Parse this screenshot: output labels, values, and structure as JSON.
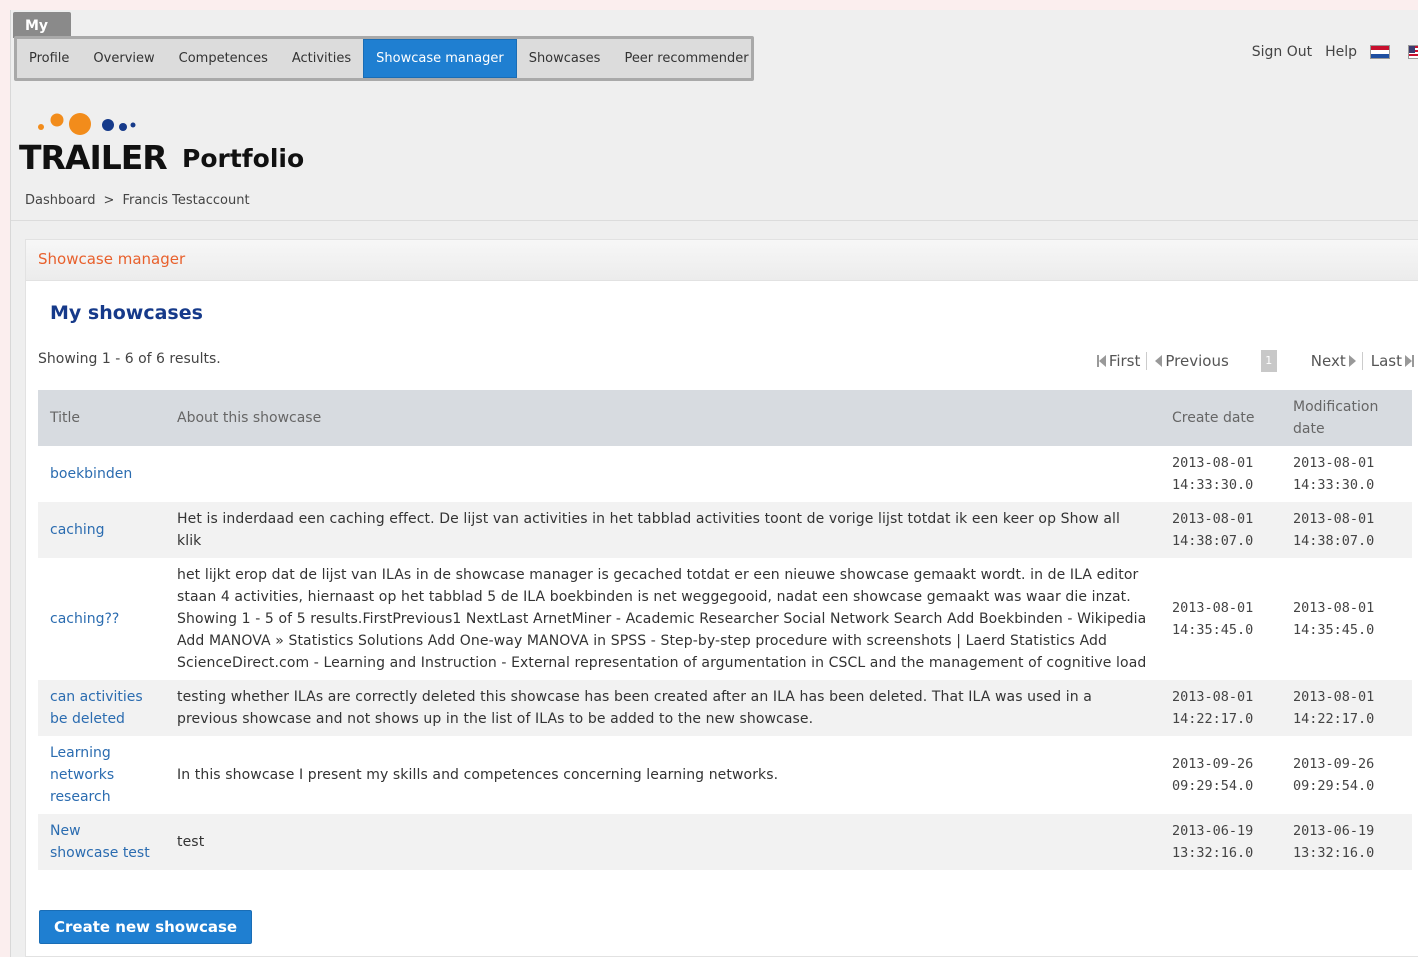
{
  "my_tab": "My",
  "nav": {
    "tabs": [
      {
        "label": "Profile"
      },
      {
        "label": "Overview"
      },
      {
        "label": "Competences"
      },
      {
        "label": "Activities"
      },
      {
        "label": "Showcase manager",
        "active": true
      },
      {
        "label": "Showcases"
      },
      {
        "label": "Peer recommender"
      }
    ]
  },
  "top_links": {
    "sign_out": "Sign Out",
    "help": "Help"
  },
  "logo": {
    "text": "TRAILER",
    "suffix": "Portfolio"
  },
  "breadcrumb": {
    "home": "Dashboard",
    "separator": ">",
    "current": "Francis Testaccount"
  },
  "panel": {
    "header": "Showcase manager",
    "title": "My showcases"
  },
  "results_text": "Showing 1 - 6 of 6 results.",
  "pager": {
    "first": "First",
    "previous": "Previous",
    "page": "1",
    "next": "Next",
    "last": "Last"
  },
  "table": {
    "headers": {
      "title": "Title",
      "about": "About this showcase",
      "create": "Create date",
      "modified": "Modification date"
    },
    "rows": [
      {
        "title": "boekbinden",
        "about": "",
        "create_date": "2013-08-01",
        "create_time": "14:33:30.0",
        "mod_date": "2013-08-01",
        "mod_time": "14:33:30.0"
      },
      {
        "title": "caching",
        "about": "Het is inderdaad een caching effect. De lijst van activities in het tabblad activities toont de vorige lijst totdat ik een keer op Show all klik",
        "create_date": "2013-08-01",
        "create_time": "14:38:07.0",
        "mod_date": "2013-08-01",
        "mod_time": "14:38:07.0"
      },
      {
        "title": "caching??",
        "about": "het lijkt erop dat de lijst van ILAs in de showcase manager is gecached totdat er een nieuwe showcase gemaakt wordt. in de ILA editor staan 4 activities, hiernaast op het tabblad 5 de ILA boekbinden is net weggegooid, nadat een showcase gemaakt was waar die inzat. Showing 1 - 5 of 5 results.FirstPrevious1 NextLast ArnetMiner - Academic Researcher Social Network Search Add Boekbinden - Wikipedia Add MANOVA » Statistics Solutions Add One-way MANOVA in SPSS - Step-by-step procedure with screenshots | Laerd Statistics Add ScienceDirect.com - Learning and Instruction - External representation of argumentation in CSCL and the management of cognitive load",
        "create_date": "2013-08-01",
        "create_time": "14:35:45.0",
        "mod_date": "2013-08-01",
        "mod_time": "14:35:45.0"
      },
      {
        "title": "can activities be deleted",
        "about": "testing whether ILAs are correctly deleted this showcase has been created after an ILA has been deleted. That ILA was used in a previous showcase and not shows up in the list of ILAs to be added to the new showcase.",
        "create_date": "2013-08-01",
        "create_time": "14:22:17.0",
        "mod_date": "2013-08-01",
        "mod_time": "14:22:17.0"
      },
      {
        "title": "Learning networks research",
        "about": "In this showcase I present my skills and competences concerning learning networks.",
        "create_date": "2013-09-26",
        "create_time": "09:29:54.0",
        "mod_date": "2013-09-26",
        "mod_time": "09:29:54.0"
      },
      {
        "title": "New showcase test",
        "about": "test",
        "create_date": "2013-06-19",
        "create_time": "13:32:16.0",
        "mod_date": "2013-06-19",
        "mod_time": "13:32:16.0"
      }
    ]
  },
  "create_button": "Create new showcase",
  "colors": {
    "accent": "#1f7fd1",
    "header_orange": "#e8602c",
    "title_navy": "#163a8a",
    "link": "#2b6cb0"
  },
  "icons": [
    "first-page-icon",
    "previous-page-icon",
    "next-page-icon",
    "last-page-icon",
    "nl-flag-icon",
    "us-flag-icon"
  ]
}
